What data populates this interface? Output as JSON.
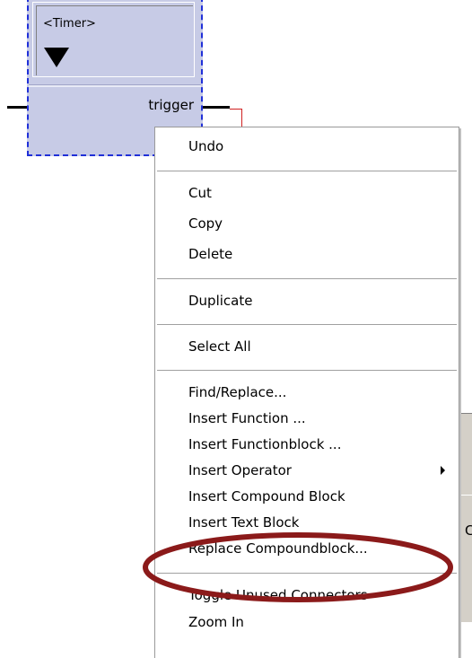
{
  "block": {
    "title": "<Timer>",
    "output_port": "trigger"
  },
  "background_panel": {
    "partial_text": "C"
  },
  "menu": {
    "items": [
      {
        "label": "Undo"
      },
      {
        "label": "Cut"
      },
      {
        "label": "Copy"
      },
      {
        "label": "Delete"
      },
      {
        "label": "Duplicate"
      },
      {
        "label": "Select All"
      },
      {
        "label": "Find/Replace..."
      },
      {
        "label": "Insert Function ..."
      },
      {
        "label": "Insert Functionblock ..."
      },
      {
        "label": "Insert Operator",
        "has_submenu": true
      },
      {
        "label": "Insert Compound Block"
      },
      {
        "label": "Insert Text Block"
      },
      {
        "label": "Replace Compoundblock..."
      },
      {
        "label": "Toggle Unused Connectors"
      },
      {
        "label": "Zoom In"
      }
    ]
  },
  "annotation": {
    "shape": "ellipse",
    "color": "#8b1a1a",
    "highlights": "Replace Compoundblock..."
  },
  "colors": {
    "block_fill": "#c7cbe6",
    "block_selection_border": "#2030d8",
    "wire": "#d02020",
    "menu_background": "#ffffff"
  }
}
